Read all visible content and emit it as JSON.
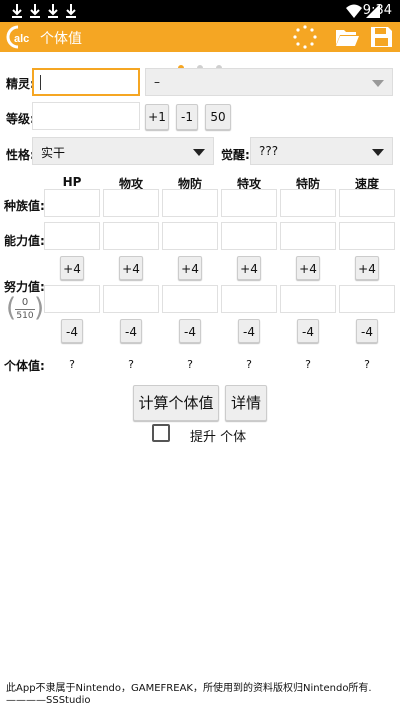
{
  "status_bar": {
    "time": "9:34"
  },
  "app_bar": {
    "logo_text": "alc",
    "title": "个体值"
  },
  "labels": {
    "pokemon": "精灵:",
    "level": "等级:",
    "nature": "性格:",
    "awaken": "觉醒:",
    "base_stats": "种族值:",
    "stats": "能力值:",
    "evs": "努力值:",
    "ivs": "个体值:"
  },
  "pokemon_select": {
    "value": "–"
  },
  "level_buttons": {
    "plus1": "+1",
    "minus1": "-1",
    "fifty": "50"
  },
  "nature_select": {
    "value": "实干"
  },
  "awaken_select": {
    "value": "???"
  },
  "stat_columns": [
    "HP",
    "物攻",
    "物防",
    "特攻",
    "特防",
    "速度"
  ],
  "ev_plus": "+4",
  "ev_minus": "-4",
  "ev_total": {
    "current": "0",
    "max": "510"
  },
  "iv_results": [
    "?",
    "?",
    "?",
    "?",
    "?",
    "?"
  ],
  "actions": {
    "calculate": "计算个体值",
    "details": "详情"
  },
  "checkbox": {
    "label": "提升 个体",
    "checked": false
  },
  "footer": "此App不隶属于Nintendo，GAMEFREAK，所使用到的资料版权归Nintendo所有.————SSStudio"
}
